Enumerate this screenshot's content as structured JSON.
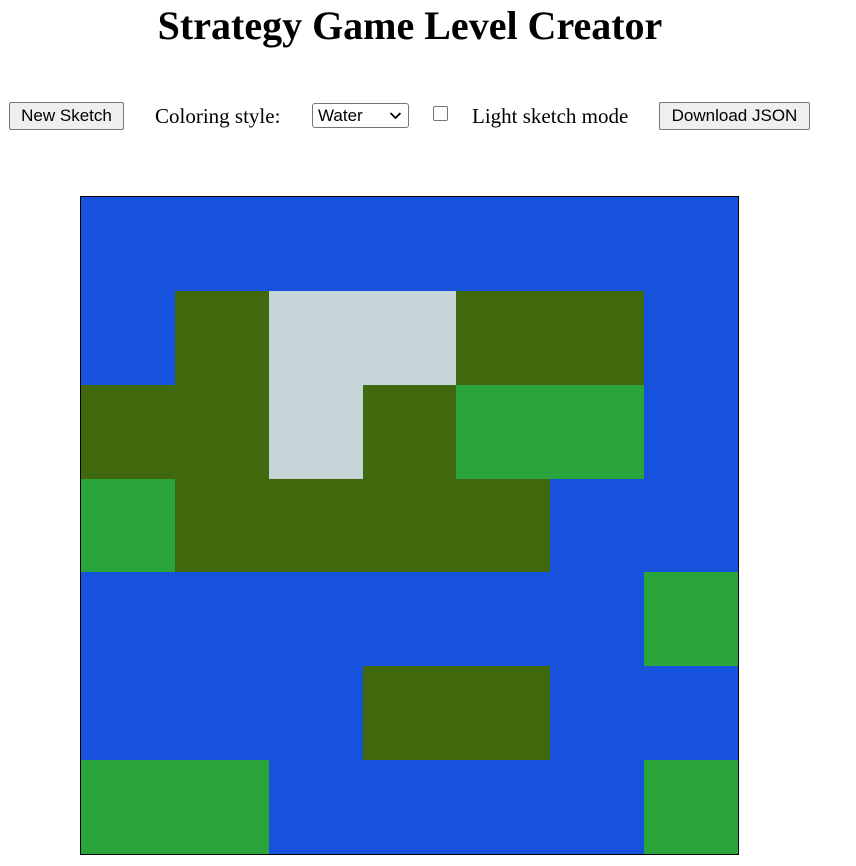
{
  "page": {
    "title": "Strategy Game Level Creator"
  },
  "toolbar": {
    "new_sketch_label": "New Sketch",
    "coloring_style_label": "Coloring style:",
    "coloring_style_value": "Water",
    "light_sketch_checked": false,
    "light_sketch_label": "Light sketch mode",
    "download_label": "Download JSON"
  },
  "terrain_colors": {
    "W": "#1752dc",
    "F": "#40680d",
    "G": "#29a53c",
    "S": "#c5d4d6"
  },
  "map_grid": [
    [
      "W",
      "W",
      "W",
      "W",
      "W",
      "W",
      "W"
    ],
    [
      "W",
      "F",
      "S",
      "S",
      "F",
      "F",
      "W"
    ],
    [
      "F",
      "F",
      "S",
      "F",
      "G",
      "G",
      "W"
    ],
    [
      "G",
      "F",
      "F",
      "F",
      "F",
      "W",
      "W"
    ],
    [
      "W",
      "W",
      "W",
      "W",
      "W",
      "W",
      "G"
    ],
    [
      "W",
      "W",
      "W",
      "F",
      "F",
      "W",
      "W"
    ],
    [
      "G",
      "G",
      "W",
      "W",
      "W",
      "W",
      "G"
    ]
  ]
}
